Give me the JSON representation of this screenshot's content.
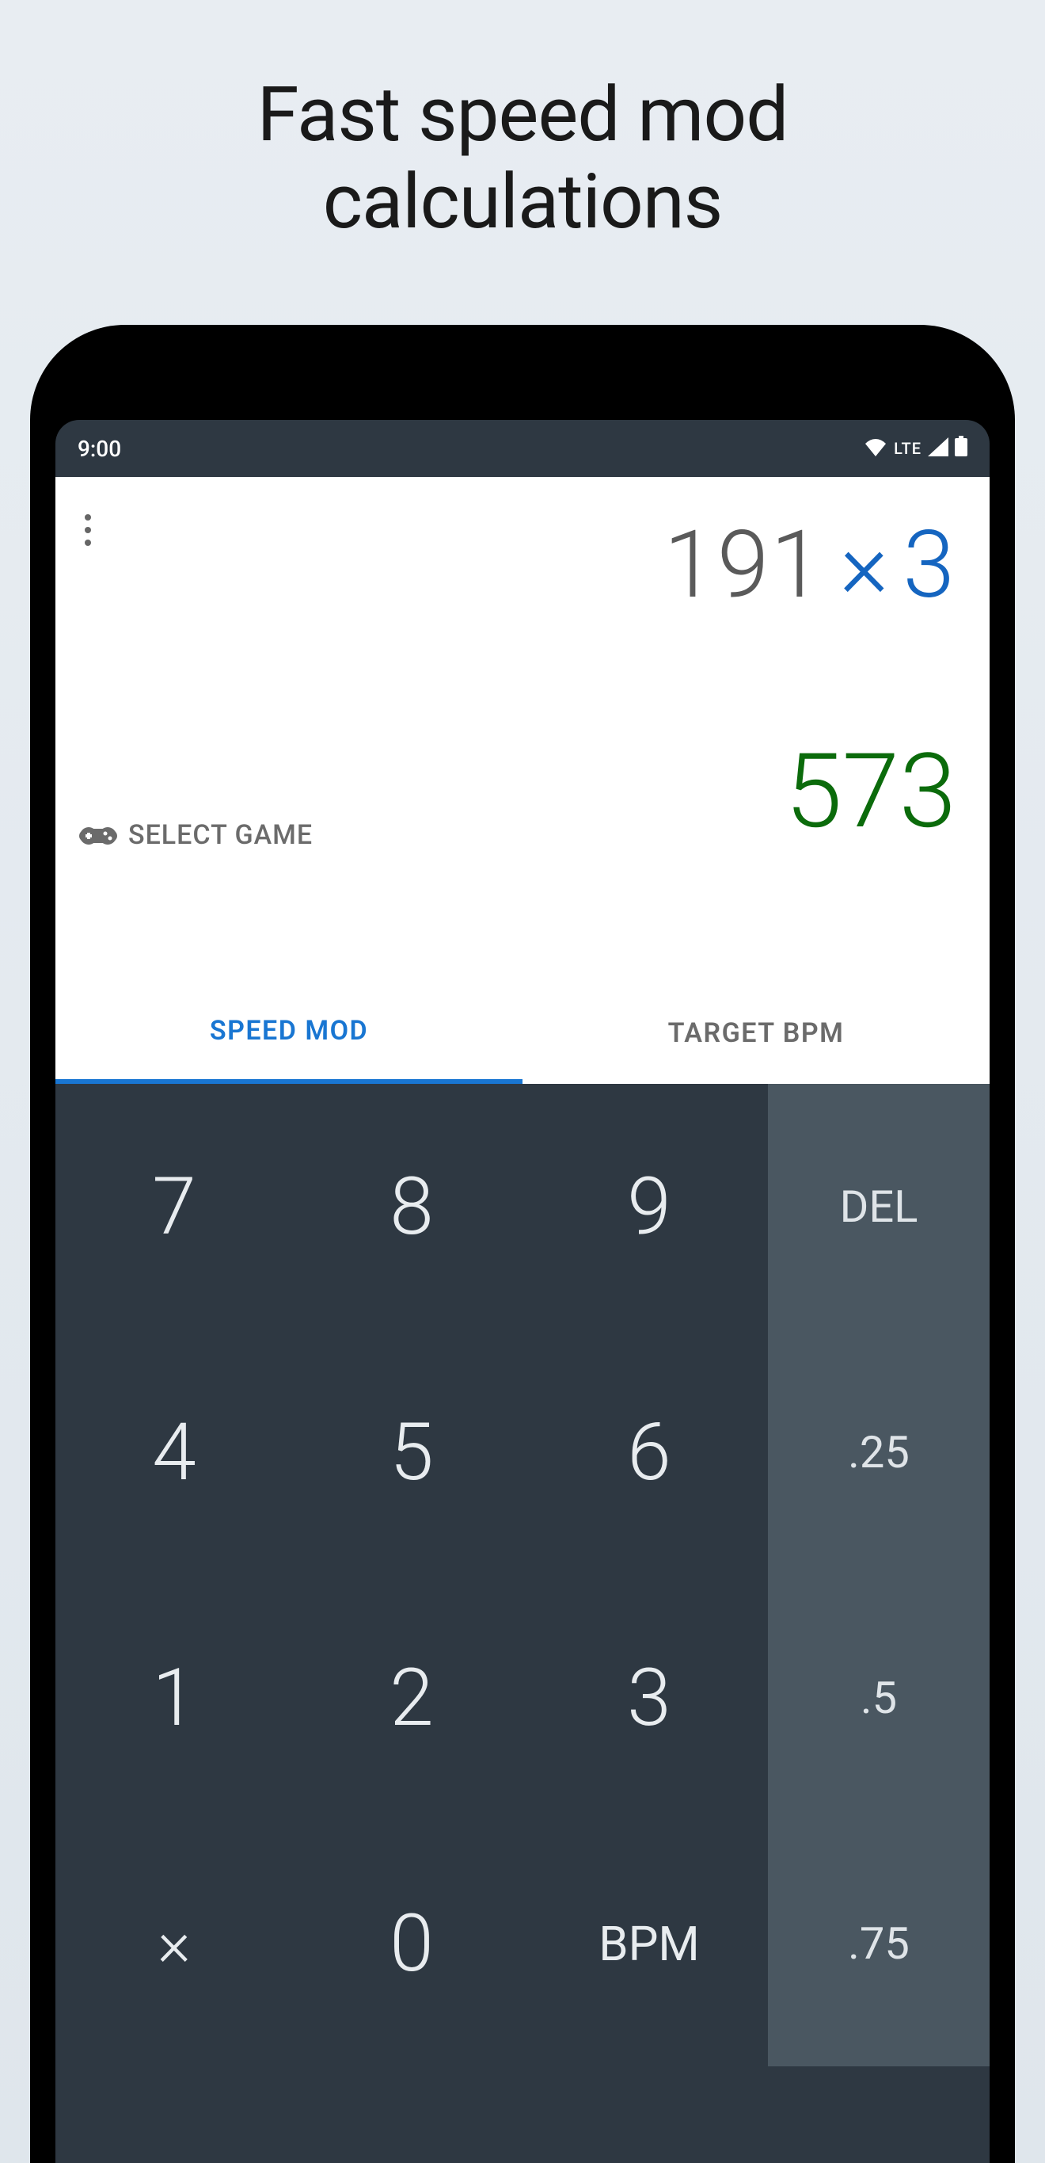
{
  "headline": "Fast speed mod\ncalculations",
  "status": {
    "time": "9:00",
    "network": "LTE"
  },
  "expression": {
    "bpm": "191",
    "operator": "×",
    "mod": "3"
  },
  "result": "573",
  "select_game": {
    "label": "SELECT GAME"
  },
  "tabs": [
    {
      "label": "SPEED MOD",
      "active": true
    },
    {
      "label": "TARGET BPM",
      "active": false
    }
  ],
  "keypad": {
    "rows": [
      [
        "7",
        "8",
        "9"
      ],
      [
        "4",
        "5",
        "6"
      ],
      [
        "1",
        "2",
        "3"
      ],
      [
        "×",
        "0",
        "BPM"
      ]
    ],
    "side": [
      "DEL",
      ".25",
      ".5",
      ".75"
    ]
  }
}
